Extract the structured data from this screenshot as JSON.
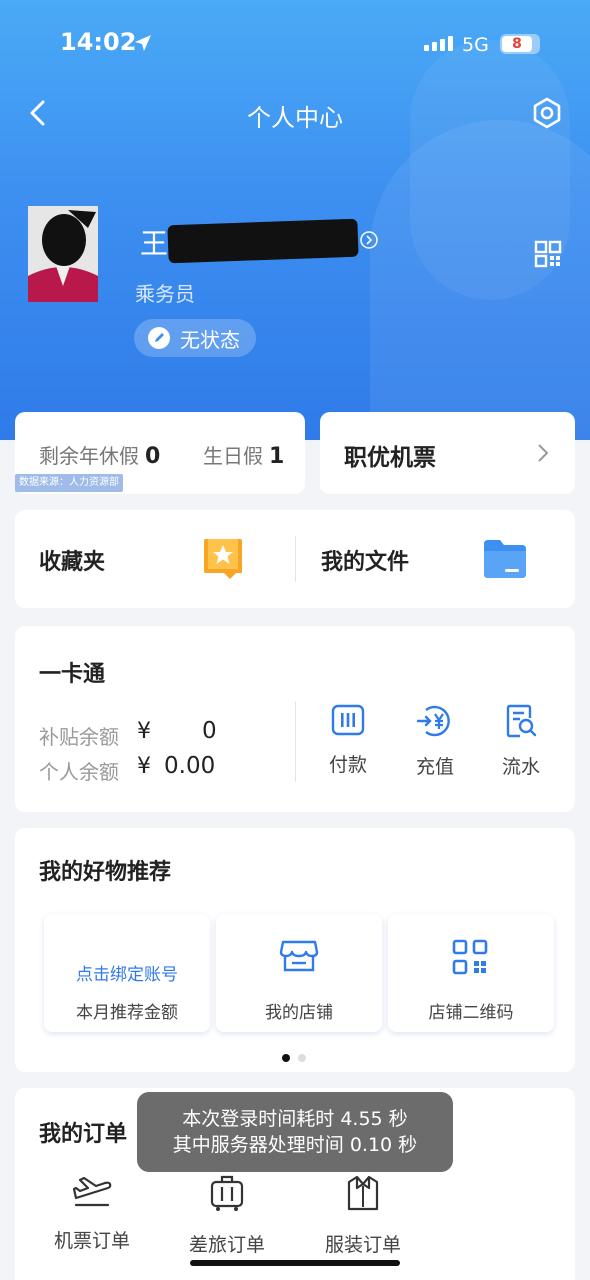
{
  "status_bar": {
    "time": "14:02",
    "network": "5G",
    "battery": "8"
  },
  "nav": {
    "title": "个人中心"
  },
  "profile": {
    "name": "王",
    "role": "乘务员",
    "status": "无状态"
  },
  "leave": {
    "annual_label": "剩余年休假",
    "annual_value": "0",
    "birthday_label": "生日假",
    "birthday_value": "1",
    "source": "数据来源：人力资源部"
  },
  "staff_ticket": {
    "label": "职优机票"
  },
  "favorites": {
    "fav_label": "收藏夹",
    "files_label": "我的文件"
  },
  "card_account": {
    "title": "一卡通",
    "subsidy_label": "补贴余额",
    "subsidy_currency": "¥",
    "subsidy_value": "0",
    "personal_label": "个人余额",
    "personal_currency": "¥",
    "personal_value": "0.00",
    "actions": [
      {
        "label": "付款",
        "icon": "barcode-icon"
      },
      {
        "label": "充值",
        "icon": "recharge-icon"
      },
      {
        "label": "流水",
        "icon": "transaction-search-icon"
      }
    ]
  },
  "recommend": {
    "title": "我的好物推荐",
    "tiles": [
      {
        "link": "点击绑定账号",
        "label": "本月推荐金额"
      },
      {
        "label": "我的店铺",
        "icon": "store-icon"
      },
      {
        "label": "店铺二维码",
        "icon": "qr-code-icon"
      }
    ]
  },
  "orders": {
    "title": "我的订单",
    "items": [
      {
        "label": "机票订单",
        "icon": "plane-icon"
      },
      {
        "label": "差旅订单",
        "icon": "luggage-icon"
      },
      {
        "label": "服装订单",
        "icon": "shirt-icon"
      }
    ]
  },
  "toast": {
    "line1": "本次登录时间耗时 4.55 秒",
    "line2": "其中服务器处理时间 0.10 秒"
  },
  "colors": {
    "accent": "#2f7be9",
    "hero_top": "#4aaaf6",
    "favorite_orange": "#f6a623",
    "folder_blue": "#3d8ff0"
  }
}
